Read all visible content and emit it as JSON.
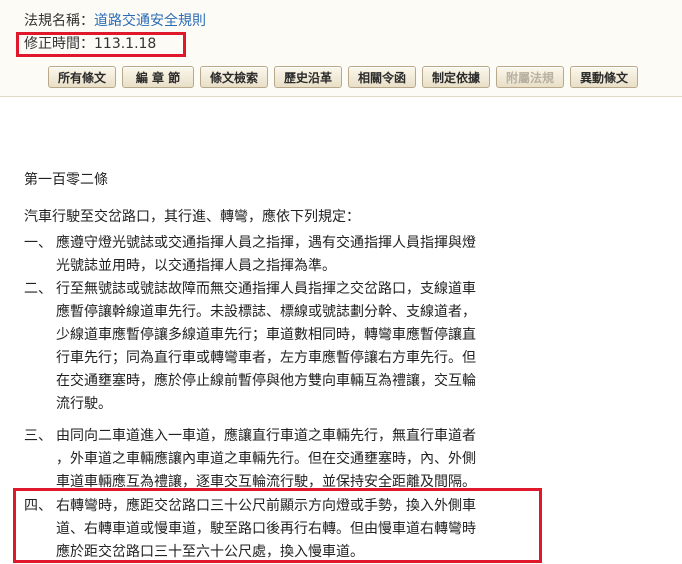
{
  "header": {
    "law_name_label": "法規名稱：",
    "law_name": "道路交通安全規則",
    "amended_label": "修正時間：",
    "amended_date": "113.1.18"
  },
  "toolbar": {
    "buttons": [
      {
        "label": "所有條文",
        "enabled": true
      },
      {
        "label": "編 章 節",
        "enabled": true
      },
      {
        "label": "條文檢索",
        "enabled": true
      },
      {
        "label": "歷史沿革",
        "enabled": true
      },
      {
        "label": "相關令函",
        "enabled": true
      },
      {
        "label": "制定依據",
        "enabled": true
      },
      {
        "label": "附屬法規",
        "enabled": false
      },
      {
        "label": "異動條文",
        "enabled": true
      }
    ]
  },
  "article": {
    "title": "第一百零二條",
    "intro": "汽車行駛至交岔路口，其行進、轉彎，應依下列規定：",
    "items": [
      {
        "num": "一、",
        "lines": [
          "應遵守燈光號誌或交通指揮人員之指揮，遇有交通指揮人員指揮與燈",
          "光號誌並用時，以交通指揮人員之指揮為準。"
        ]
      },
      {
        "num": "二、",
        "lines": [
          "行至無號誌或號誌故障而無交通指揮人員指揮之交岔路口，支線道車",
          "應暫停讓幹線道車先行。未設標誌、標線或號誌劃分幹、支線道者，",
          "少線道車應暫停讓多線道車先行；車道數相同時，轉彎車應暫停讓直",
          "行車先行；同為直行車或轉彎車者，左方車應暫停讓右方車先行。但",
          "在交通壅塞時，應於停止線前暫停與他方雙向車輛互為禮讓，交互輪",
          "流行駛。"
        ]
      },
      {
        "num": "三、",
        "lines": [
          "由同向二車道進入一車道，應讓直行車道之車輛先行，無直行車道者",
          "，外車道之車輛應讓內車道之車輛先行。但在交通壅塞時，內、外側",
          "車道車輛應互為禮讓，逐車交互輪流行駛，並保持安全距離及間隔。"
        ]
      },
      {
        "num": "四、",
        "lines": [
          "右轉彎時，應距交岔路口三十公尺前顯示方向燈或手勢，換入外側車",
          "道、右轉車道或慢車道，駛至路口後再行右轉。但由慢車道右轉彎時",
          "應於距交岔路口三十至六十公尺處，換入慢車道。"
        ]
      }
    ]
  },
  "colors": {
    "highlight_box": "#e0182b",
    "link": "#2a6db5",
    "header_bg": "#fdfbf6"
  }
}
